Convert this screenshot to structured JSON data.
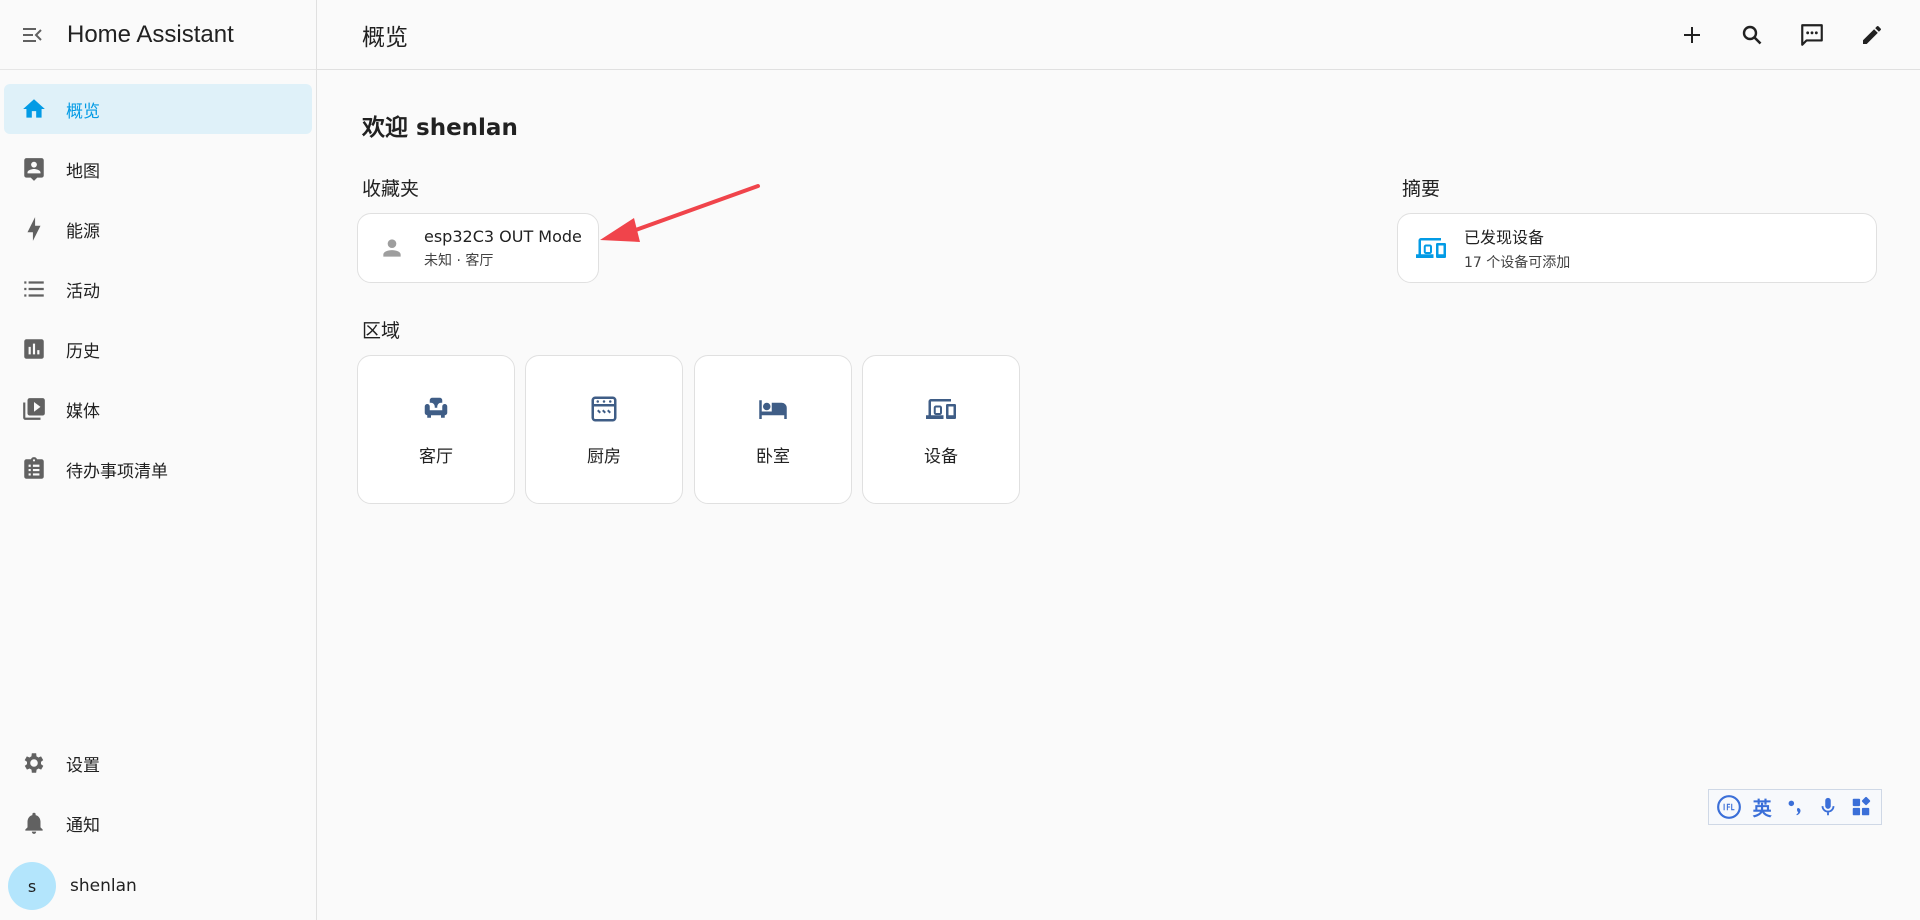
{
  "sidebar": {
    "title": "Home Assistant",
    "items": [
      {
        "label": "概览",
        "icon": "home-icon",
        "active": true
      },
      {
        "label": "地图",
        "icon": "map-icon",
        "active": false
      },
      {
        "label": "能源",
        "icon": "lightning-icon",
        "active": false
      },
      {
        "label": "活动",
        "icon": "list-icon",
        "active": false
      },
      {
        "label": "历史",
        "icon": "chart-icon",
        "active": false
      },
      {
        "label": "媒体",
        "icon": "media-icon",
        "active": false
      },
      {
        "label": "待办事项清单",
        "icon": "clipboard-list-icon",
        "active": false
      }
    ],
    "bottom": {
      "settings": "设置",
      "notifications": "通知",
      "user_initial": "s",
      "user_name": "shenlan"
    }
  },
  "topbar": {
    "title": "概览",
    "actions": [
      "plus-icon",
      "search-icon",
      "assist-icon",
      "pencil-icon"
    ]
  },
  "main": {
    "welcome": "欢迎 shenlan",
    "favorites": {
      "title": "收藏夹",
      "card": {
        "name": "esp32C3 OUT Mode",
        "sub": "未知 · 客厅"
      }
    },
    "summary": {
      "title": "摘要",
      "card": {
        "name": "已发现设备",
        "sub": "17 个设备可添加"
      }
    },
    "areas": {
      "title": "区域",
      "items": [
        {
          "label": "客厅",
          "icon": "sofa-icon"
        },
        {
          "label": "厨房",
          "icon": "stove-icon"
        },
        {
          "label": "卧室",
          "icon": "bed-icon"
        },
        {
          "label": "设备",
          "icon": "devices-icon"
        }
      ]
    }
  },
  "ime": {
    "lang": "英"
  },
  "colors": {
    "accent": "#039be5",
    "active_bg": "#dff1f9",
    "area_icon": "#3f5d86",
    "arrow": "#f0444b",
    "ime": "#3b6fd8"
  }
}
